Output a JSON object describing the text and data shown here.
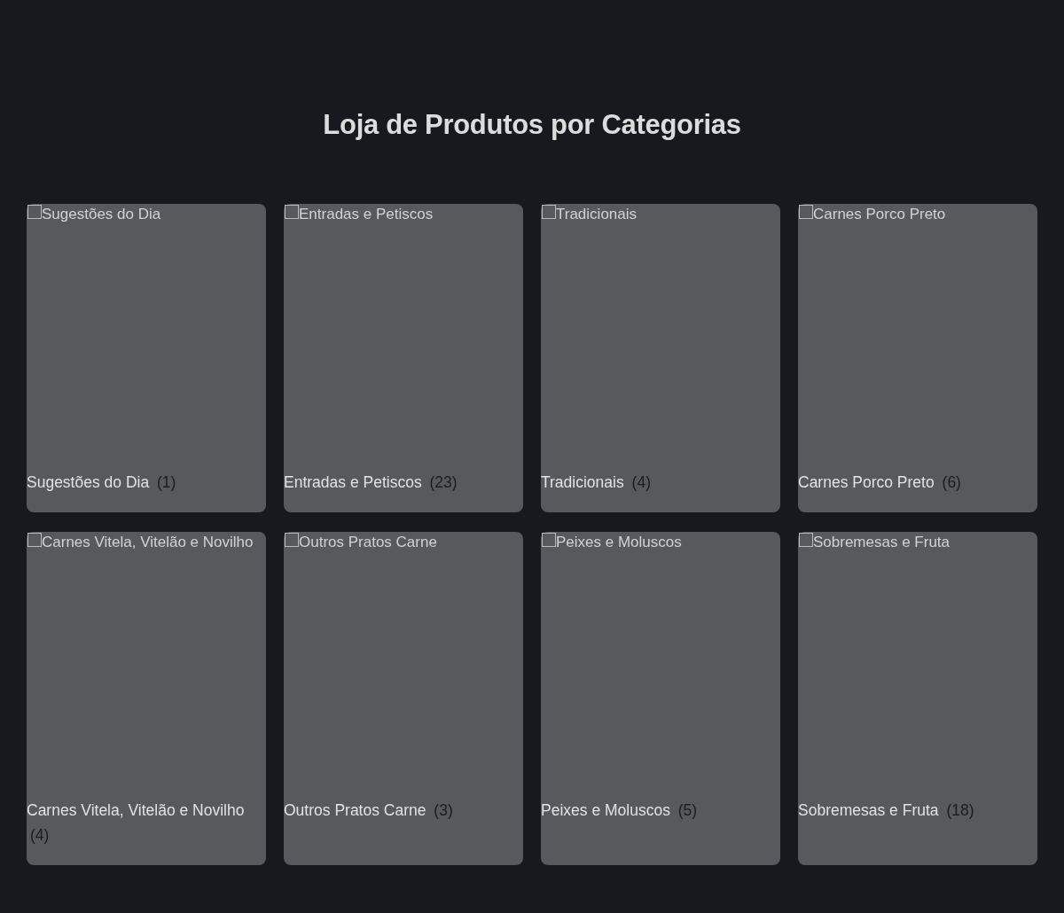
{
  "page": {
    "title": "Loja de Produtos por Categorias"
  },
  "categories": [
    {
      "image_alt": "Sugestões do Dia",
      "name": "Sugestões do Dia",
      "count": "(1)"
    },
    {
      "image_alt": "Entradas e Petiscos",
      "name": "Entradas e Petiscos",
      "count": "(23)"
    },
    {
      "image_alt": "Tradicionais",
      "name": "Tradicionais",
      "count": "(4)"
    },
    {
      "image_alt": "Carnes Porco Preto",
      "name": "Carnes Porco Preto",
      "count": "(6)"
    },
    {
      "image_alt": "Carnes Vitela, Vitelão e Novilho",
      "name": "Carnes Vitela, Vitelão e Novilho",
      "count": "(4)"
    },
    {
      "image_alt": "Outros Pratos Carne",
      "name": "Outros Pratos Carne",
      "count": "(3)"
    },
    {
      "image_alt": "Peixes e Moluscos",
      "name": "Peixes e Moluscos",
      "count": "(5)"
    },
    {
      "image_alt": "Sobremesas e Fruta",
      "name": "Sobremesas e Fruta",
      "count": "(18)"
    }
  ]
}
